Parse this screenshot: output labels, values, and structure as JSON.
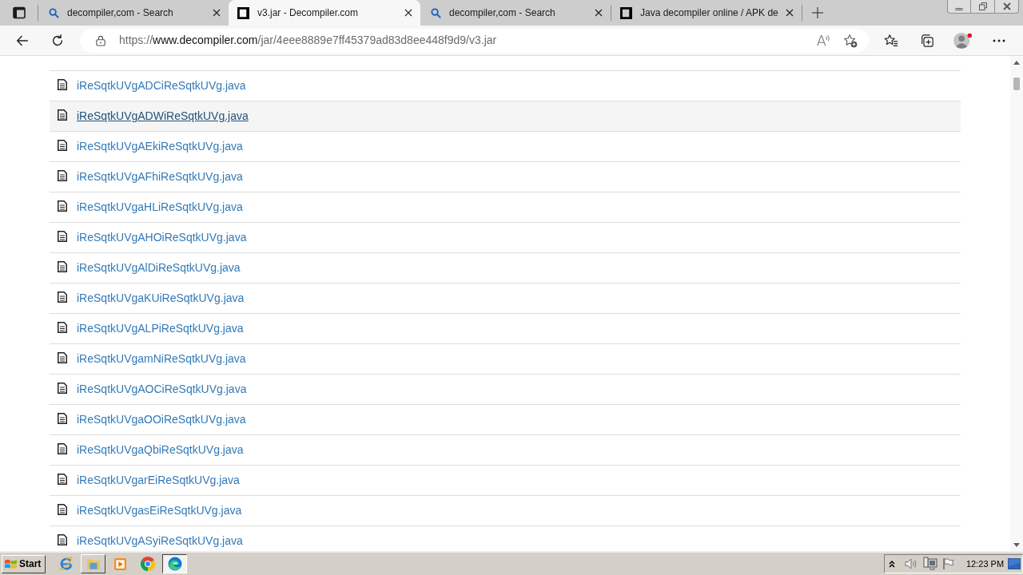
{
  "tabs": [
    {
      "kind": "search",
      "title": "decompiler,com - Search",
      "selected": false
    },
    {
      "kind": "site",
      "title": "v3.jar - Decompiler.com",
      "selected": true
    },
    {
      "kind": "search",
      "title": "decompiler,com - Search",
      "selected": false
    },
    {
      "kind": "site",
      "title": "Java decompiler online / APK de",
      "selected": false
    }
  ],
  "address_bar": {
    "scheme": "https://",
    "host": "www.decompiler.com",
    "path": "/jar/4eee8889e7ff45379ad83d8ee448f9d9/v3.jar"
  },
  "files": [
    {
      "name": "iReSqtkUVgADCiReSqtkUVg.java",
      "hovered": false
    },
    {
      "name": "iReSqtkUVgADWiReSqtkUVg.java",
      "hovered": true
    },
    {
      "name": "iReSqtkUVgAEkiReSqtkUVg.java",
      "hovered": false
    },
    {
      "name": "iReSqtkUVgAFhiReSqtkUVg.java",
      "hovered": false
    },
    {
      "name": "iReSqtkUVgaHLiReSqtkUVg.java",
      "hovered": false
    },
    {
      "name": "iReSqtkUVgAHOiReSqtkUVg.java",
      "hovered": false
    },
    {
      "name": "iReSqtkUVgAlDiReSqtkUVg.java",
      "hovered": false
    },
    {
      "name": "iReSqtkUVgaKUiReSqtkUVg.java",
      "hovered": false
    },
    {
      "name": "iReSqtkUVgALPiReSqtkUVg.java",
      "hovered": false
    },
    {
      "name": "iReSqtkUVgamNiReSqtkUVg.java",
      "hovered": false
    },
    {
      "name": "iReSqtkUVgAOCiReSqtkUVg.java",
      "hovered": false
    },
    {
      "name": "iReSqtkUVgaOOiReSqtkUVg.java",
      "hovered": false
    },
    {
      "name": "iReSqtkUVgaQbiReSqtkUVg.java",
      "hovered": false
    },
    {
      "name": "iReSqtkUVgarEiReSqtkUVg.java",
      "hovered": false
    },
    {
      "name": "iReSqtkUVgasEiReSqtkUVg.java",
      "hovered": false
    },
    {
      "name": "iReSqtkUVgASyiReSqtkUVg.java",
      "hovered": false
    }
  ],
  "taskbar": {
    "start_label": "Start",
    "apps": [
      {
        "kind": "e_logo",
        "open": false,
        "selected": false
      },
      {
        "kind": "folder",
        "open": true,
        "selected": false
      },
      {
        "kind": "player",
        "open": false,
        "selected": false
      },
      {
        "kind": "ring_logo",
        "open": false,
        "selected": false
      },
      {
        "kind": "swirl_logo",
        "open": true,
        "selected": true
      }
    ],
    "clock": "12:23 PM"
  }
}
